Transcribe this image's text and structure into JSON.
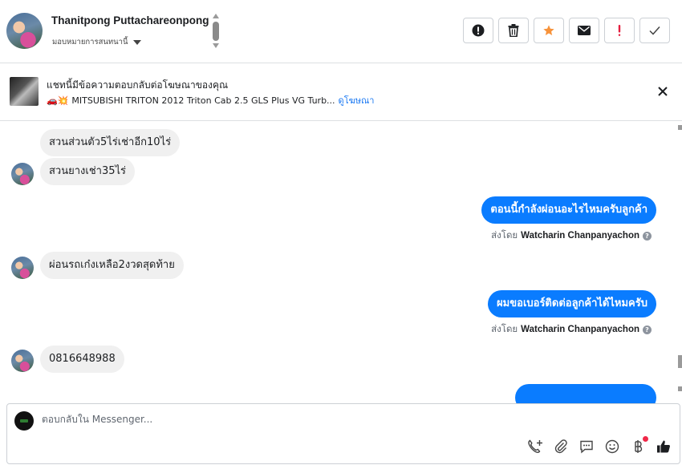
{
  "header": {
    "contact_name": "Thanitpong Puttachareonpong",
    "assign_label": "มอบหมายการสนทนานี้",
    "actions": [
      {
        "name": "spam-button",
        "icon": "exclamation-circle-icon"
      },
      {
        "name": "delete-button",
        "icon": "trash-icon"
      },
      {
        "name": "star-button",
        "icon": "star-icon",
        "color": "#f7923a"
      },
      {
        "name": "mark-unread-button",
        "icon": "envelope-icon"
      },
      {
        "name": "follow-up-button",
        "icon": "exclamation-icon",
        "color": "#e41e3f"
      },
      {
        "name": "mark-done-button",
        "icon": "check-icon"
      }
    ]
  },
  "ad_context": {
    "title": "แชทนี้มีข้อความตอบกลับต่อโฆษณาของคุณ",
    "emoji": "🚗💥",
    "product": "MITSUBISHI TRITON 2012 Triton Cab 2.5 GLS Plus VG Turb...",
    "view_ad_link": "ดูโฆษณา"
  },
  "messages": {
    "m1": "สวนส่วนตัว5ไร่เช่าอีก10ไร่",
    "m2": "สวนยางเช่า35ไร่",
    "m3": "ตอนนี้กำลังผ่อนอะไรไหมครับลูกค้า",
    "m3_sent_prefix": "ส่งโดย",
    "m3_sent_by": "Watcharin Chanpanyachon",
    "m4": "ผ่อนรถเก๋งเหลือ2งวดสุดท้าย",
    "m5": "ผมขอเบอร์ติดต่อลูกค้าได้ไหมครับ",
    "m5_sent_prefix": "ส่งโดย",
    "m5_sent_by": "Watcharin Chanpanyachon",
    "m6": "0816648988"
  },
  "composer": {
    "placeholder": "ตอบกลับใน Messenger...",
    "tools": [
      "call-add-icon",
      "attachment-icon",
      "saved-reply-icon",
      "emoji-icon",
      "payment-icon",
      "like-icon"
    ]
  },
  "colors": {
    "outgoing_bubble": "#0a7cff",
    "incoming_bubble": "#f0f0f0",
    "link": "#1877f2"
  }
}
